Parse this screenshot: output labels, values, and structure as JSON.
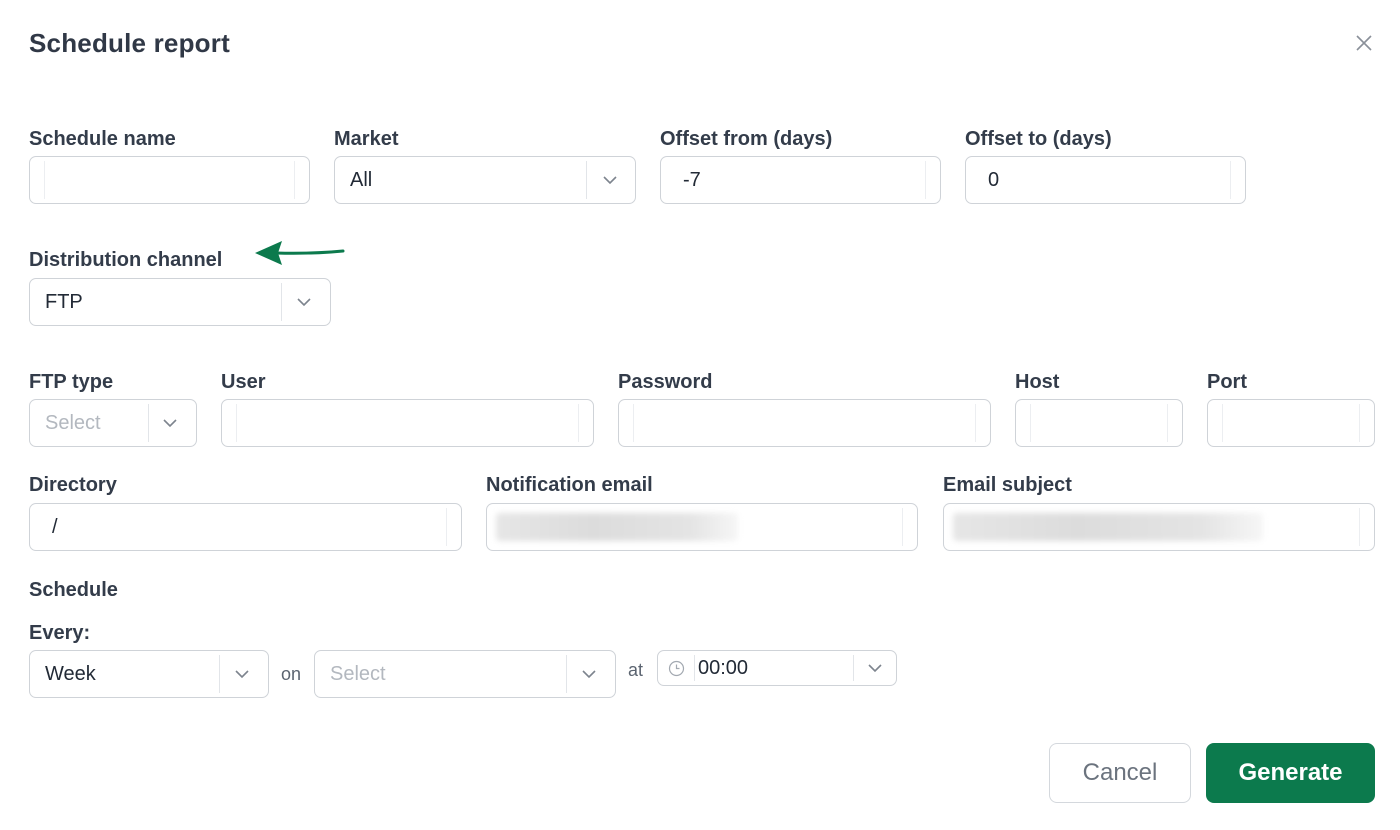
{
  "dialog": {
    "title": "Schedule report"
  },
  "fields": {
    "schedule_name": {
      "label": "Schedule name",
      "value": ""
    },
    "market": {
      "label": "Market",
      "value": "All"
    },
    "offset_from": {
      "label": "Offset from (days)",
      "value": "-7"
    },
    "offset_to": {
      "label": "Offset to (days)",
      "value": "0"
    },
    "distribution_channel": {
      "label": "Distribution channel",
      "value": "FTP"
    },
    "ftp_type": {
      "label": "FTP type",
      "placeholder": "Select"
    },
    "user": {
      "label": "User",
      "value": ""
    },
    "password": {
      "label": "Password",
      "value": ""
    },
    "host": {
      "label": "Host",
      "value": ""
    },
    "port": {
      "label": "Port",
      "value": ""
    },
    "directory": {
      "label": "Directory",
      "value": "/"
    },
    "notification_email": {
      "label": "Notification email",
      "value": ""
    },
    "email_subject": {
      "label": "Email subject",
      "value": ""
    }
  },
  "schedule": {
    "heading": "Schedule",
    "every_label": "Every:",
    "every_value": "Week",
    "on_label": "on",
    "on_placeholder": "Select",
    "at_label": "at",
    "time_value": "00:00"
  },
  "buttons": {
    "cancel": "Cancel",
    "generate": "Generate"
  },
  "colors": {
    "primary": "#0c7a4d",
    "annotation_arrow": "#0c7a4d",
    "border": "#cfd3d8"
  }
}
